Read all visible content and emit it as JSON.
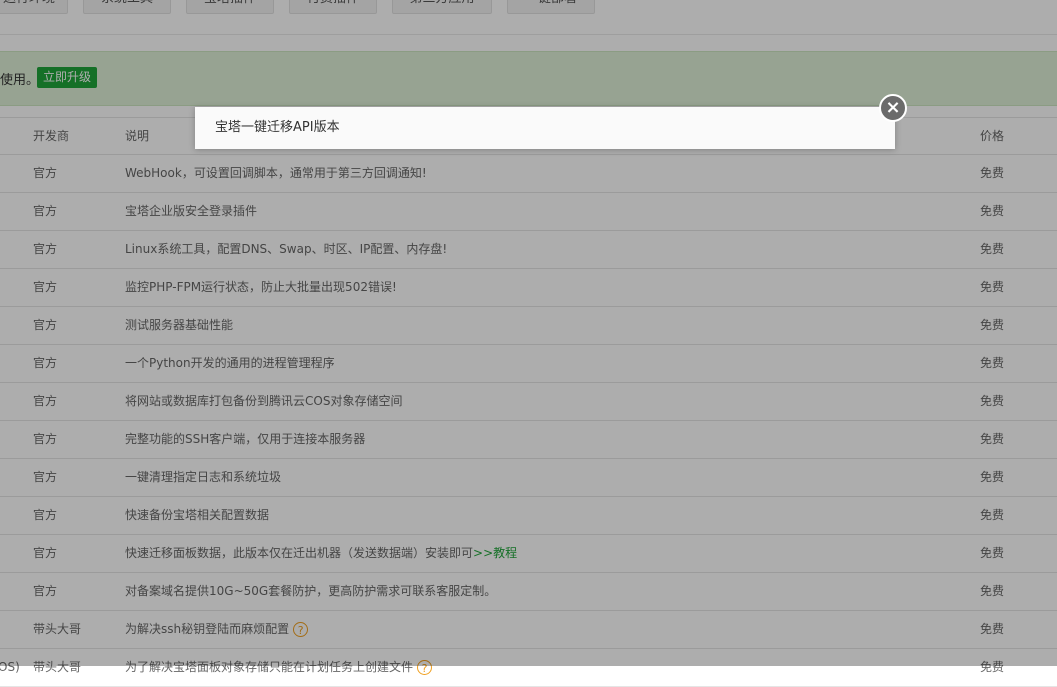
{
  "top_tabs": [
    "运行环境",
    "系统工具",
    "宝塔插件",
    "付费插件",
    "第三方应用",
    "一键部署"
  ],
  "notice": {
    "text_fragment": "使用。",
    "upgrade_button": "立即升级"
  },
  "table": {
    "headers": {
      "developer": "开发商",
      "description": "说明",
      "price": "价格"
    },
    "rows": [
      {
        "extra": "",
        "developer": "官方",
        "description": "WebHook，可设置回调脚本，通常用于第三方回调通知!",
        "link": "",
        "help": false,
        "price": "免费"
      },
      {
        "extra": "",
        "developer": "官方",
        "description": "宝塔企业版安全登录插件",
        "link": "",
        "help": false,
        "price": "免费"
      },
      {
        "extra": "",
        "developer": "官方",
        "description": "Linux系统工具，配置DNS、Swap、时区、IP配置、内存盘!",
        "link": "",
        "help": false,
        "price": "免费"
      },
      {
        "extra": "",
        "developer": "官方",
        "description": "监控PHP-FPM运行状态，防止大批量出现502错误!",
        "link": "",
        "help": false,
        "price": "免费"
      },
      {
        "extra": "",
        "developer": "官方",
        "description": "测试服务器基础性能",
        "link": "",
        "help": false,
        "price": "免费"
      },
      {
        "extra": "",
        "developer": "官方",
        "description": "一个Python开发的通用的进程管理程序",
        "link": "",
        "help": false,
        "price": "免费"
      },
      {
        "extra": "",
        "developer": "官方",
        "description": "将网站或数据库打包备份到腾讯云COS对象存储空间",
        "link": "",
        "help": false,
        "price": "免费"
      },
      {
        "extra": "",
        "developer": "官方",
        "description": "完整功能的SSH客户端，仅用于连接本服务器",
        "link": "",
        "help": false,
        "price": "免费"
      },
      {
        "extra": "",
        "developer": "官方",
        "description": "一键清理指定日志和系统垃圾",
        "link": "",
        "help": false,
        "price": "免费"
      },
      {
        "extra": "",
        "developer": "官方",
        "description": "快速备份宝塔相关配置数据",
        "link": "",
        "help": false,
        "price": "免费"
      },
      {
        "extra": "",
        "developer": "官方",
        "description": "快速迁移面板数据，此版本仅在迁出机器（发送数据端）安装即可",
        "link": ">>教程",
        "help": false,
        "price": "免费"
      },
      {
        "extra": "",
        "developer": "官方",
        "description": "对备案域名提供10G~50G套餐防护，更高防护需求可联系客服定制。",
        "link": "",
        "help": false,
        "price": "免费"
      },
      {
        "extra": "",
        "developer": "带头大哥",
        "description": "为解决ssh秘钥登陆而麻烦配置",
        "link": "",
        "help": true,
        "price": "免费"
      },
      {
        "extra": "OS)",
        "developer": "带头大哥",
        "description": "为了解决宝塔面板对象存储只能在计划任务上创建文件",
        "link": "",
        "help": true,
        "price": "免费"
      }
    ]
  },
  "dialog": {
    "title": "宝塔一键迁移API版本",
    "close_symbol": "×"
  }
}
